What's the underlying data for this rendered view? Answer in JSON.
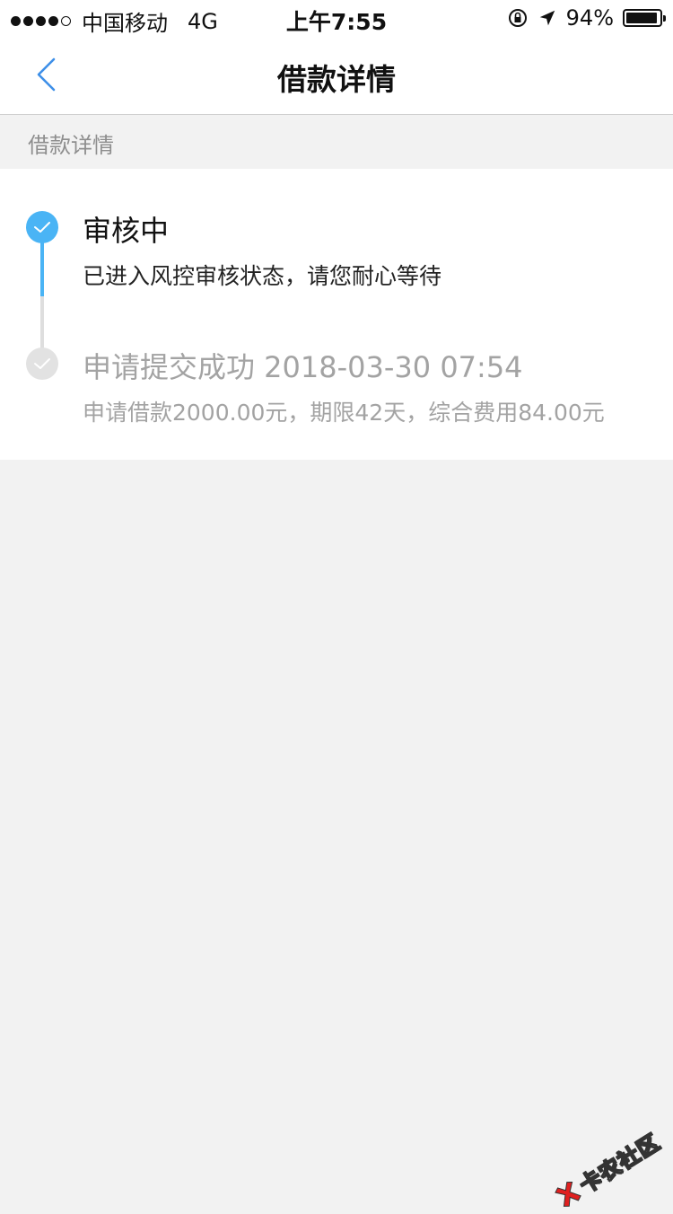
{
  "status_bar": {
    "carrier": "中国移动",
    "network": "4G",
    "time": "上午7:55",
    "battery_text": "94%",
    "battery_level": 0.94,
    "icons": [
      "orientation-lock-icon",
      "location-arrow-icon"
    ]
  },
  "nav": {
    "title": "借款详情",
    "back_icon": "chevron-left-icon"
  },
  "section": {
    "header": "借款详情"
  },
  "timeline": {
    "steps": [
      {
        "title": "审核中",
        "description": "已进入风控审核状态，请您耐心等待",
        "state": "active"
      },
      {
        "title": "申请提交成功 2018-03-30 07:54",
        "description": "申请借款2000.00元，期限42天，综合费用84.00元",
        "state": "completed"
      }
    ]
  },
  "watermark": {
    "text": "卡农社区"
  },
  "colors": {
    "accent": "#4ab4f5",
    "inactive_node": "#e2e2e2",
    "muted_text": "#a3a3a3",
    "background": "#f2f2f2"
  }
}
